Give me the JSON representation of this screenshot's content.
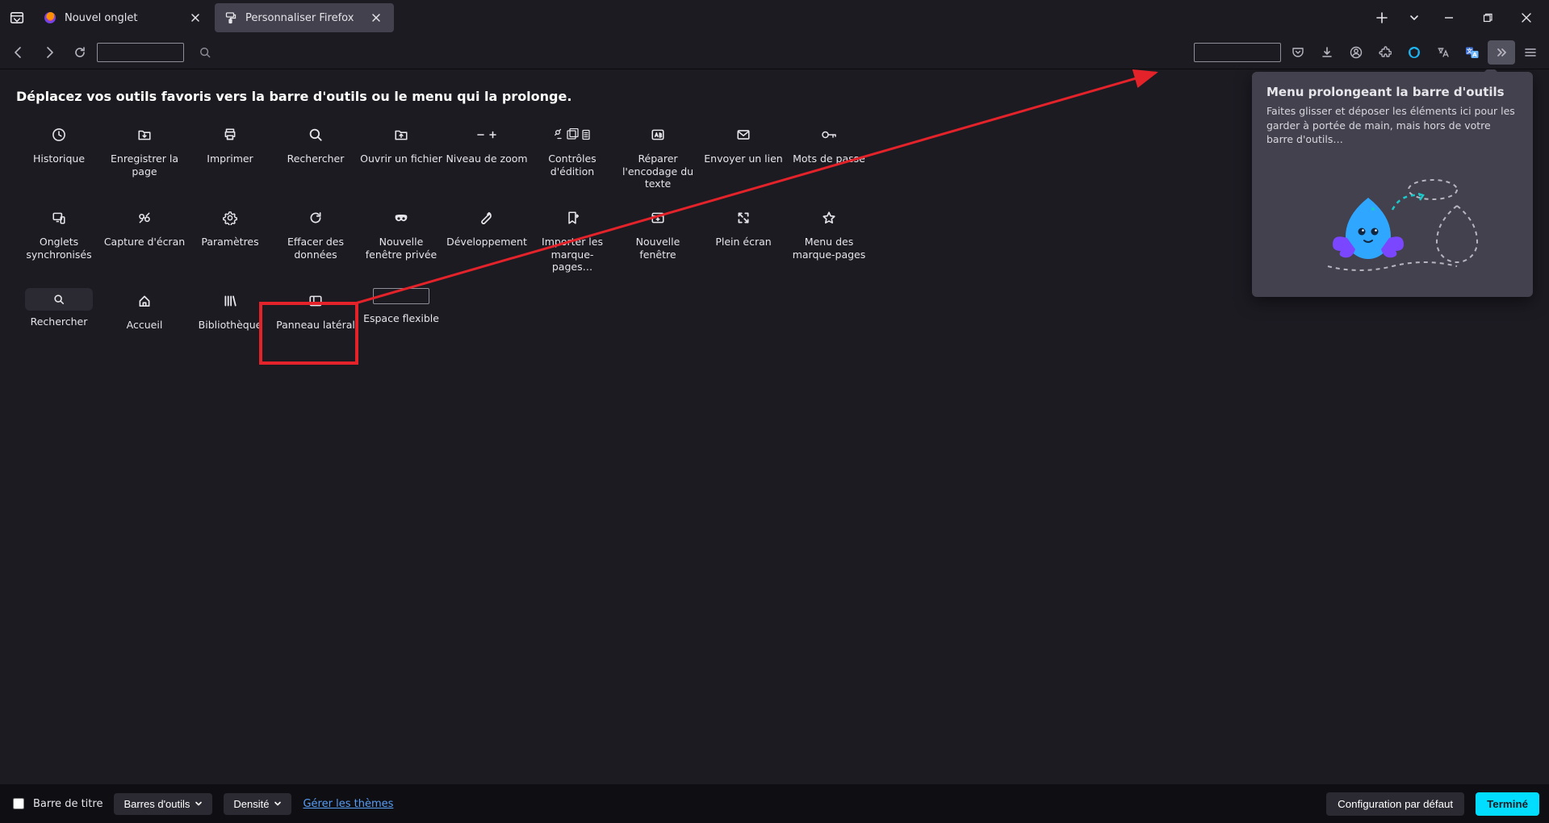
{
  "tabs": {
    "tab1": "Nouvel onglet",
    "tab2": "Personnaliser Firefox"
  },
  "customize": {
    "heading": "Déplacez vos outils favoris vers la barre d'outils ou le menu qui la prolonge.",
    "tools": {
      "history": "Historique",
      "savepage": "Enregistrer la page",
      "print": "Imprimer",
      "search": "Rechercher",
      "openfile": "Ouvrir un fichier",
      "zoom": "Niveau de zoom",
      "editcontrols": "Contrôles d'édition",
      "textencoding": "Réparer l'encodage du texte",
      "sendlink": "Envoyer un lien",
      "passwords": "Mots de passe",
      "syncedtabs": "Onglets synchronisés",
      "screenshot": "Capture d'écran",
      "settings": "Paramètres",
      "cleardata": "Effacer des données",
      "privatewindow": "Nouvelle fenêtre privée",
      "devtools": "Développement",
      "importbookmarks": "Importer les marque-pages…",
      "newwindow": "Nouvelle fenêtre",
      "fullscreen": "Plein écran",
      "bookmarksmenu": "Menu des marque-pages",
      "search2": "Rechercher",
      "home": "Accueil",
      "library": "Bibliothèque",
      "sidebar": "Panneau latéral",
      "flexspace": "Espace flexible"
    }
  },
  "overflow": {
    "title": "Menu prolongeant la barre d'outils",
    "desc": "Faites glisser et déposer les éléments ici pour les garder à portée de main, mais hors de votre barre d'outils…"
  },
  "footer": {
    "titlebar": "Barre de titre",
    "toolbars": "Barres d'outils",
    "density": "Densité",
    "managethemes": "Gérer les thèmes",
    "defaultconfig": "Configuration par défaut",
    "done": "Terminé"
  }
}
